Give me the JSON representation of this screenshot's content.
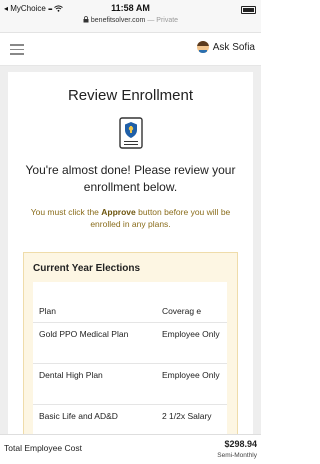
{
  "status_bar": {
    "carrier": "◂ MyChoice",
    "signal": "▪▪▪",
    "wifi": "wifi-icon",
    "time": "11:58 AM",
    "url": "benefitsolver.com",
    "mode": "— Private"
  },
  "header": {
    "menu_icon": "hamburger-icon",
    "ask_sofia_label": "Ask Sofia"
  },
  "page": {
    "title": "Review Enrollment",
    "done_message": "You're almost done! Please review your enrollment below.",
    "approve_prefix": "You must click the ",
    "approve_word": "Approve",
    "approve_suffix": " button before you will be enrolled in any plans."
  },
  "elections": {
    "title": "Current Year Elections",
    "columns": [
      "Plan",
      "Coverag e"
    ],
    "rows": [
      {
        "plan": "Gold PPO Medical Plan",
        "coverage": "Employee Only"
      },
      {
        "plan": "Dental High Plan",
        "coverage": "Employee Only"
      },
      {
        "plan": "Basic Life and AD&D",
        "coverage": "2 1/2x Salary"
      }
    ]
  },
  "footer": {
    "label": "Total Employee Cost",
    "amount": "$298.94",
    "frequency": "Semi-Monthly"
  },
  "colors": {
    "panel_bg": "#fdf6e3",
    "warning_text": "#8a6d1c",
    "icon_blue": "#1f5fa8"
  }
}
